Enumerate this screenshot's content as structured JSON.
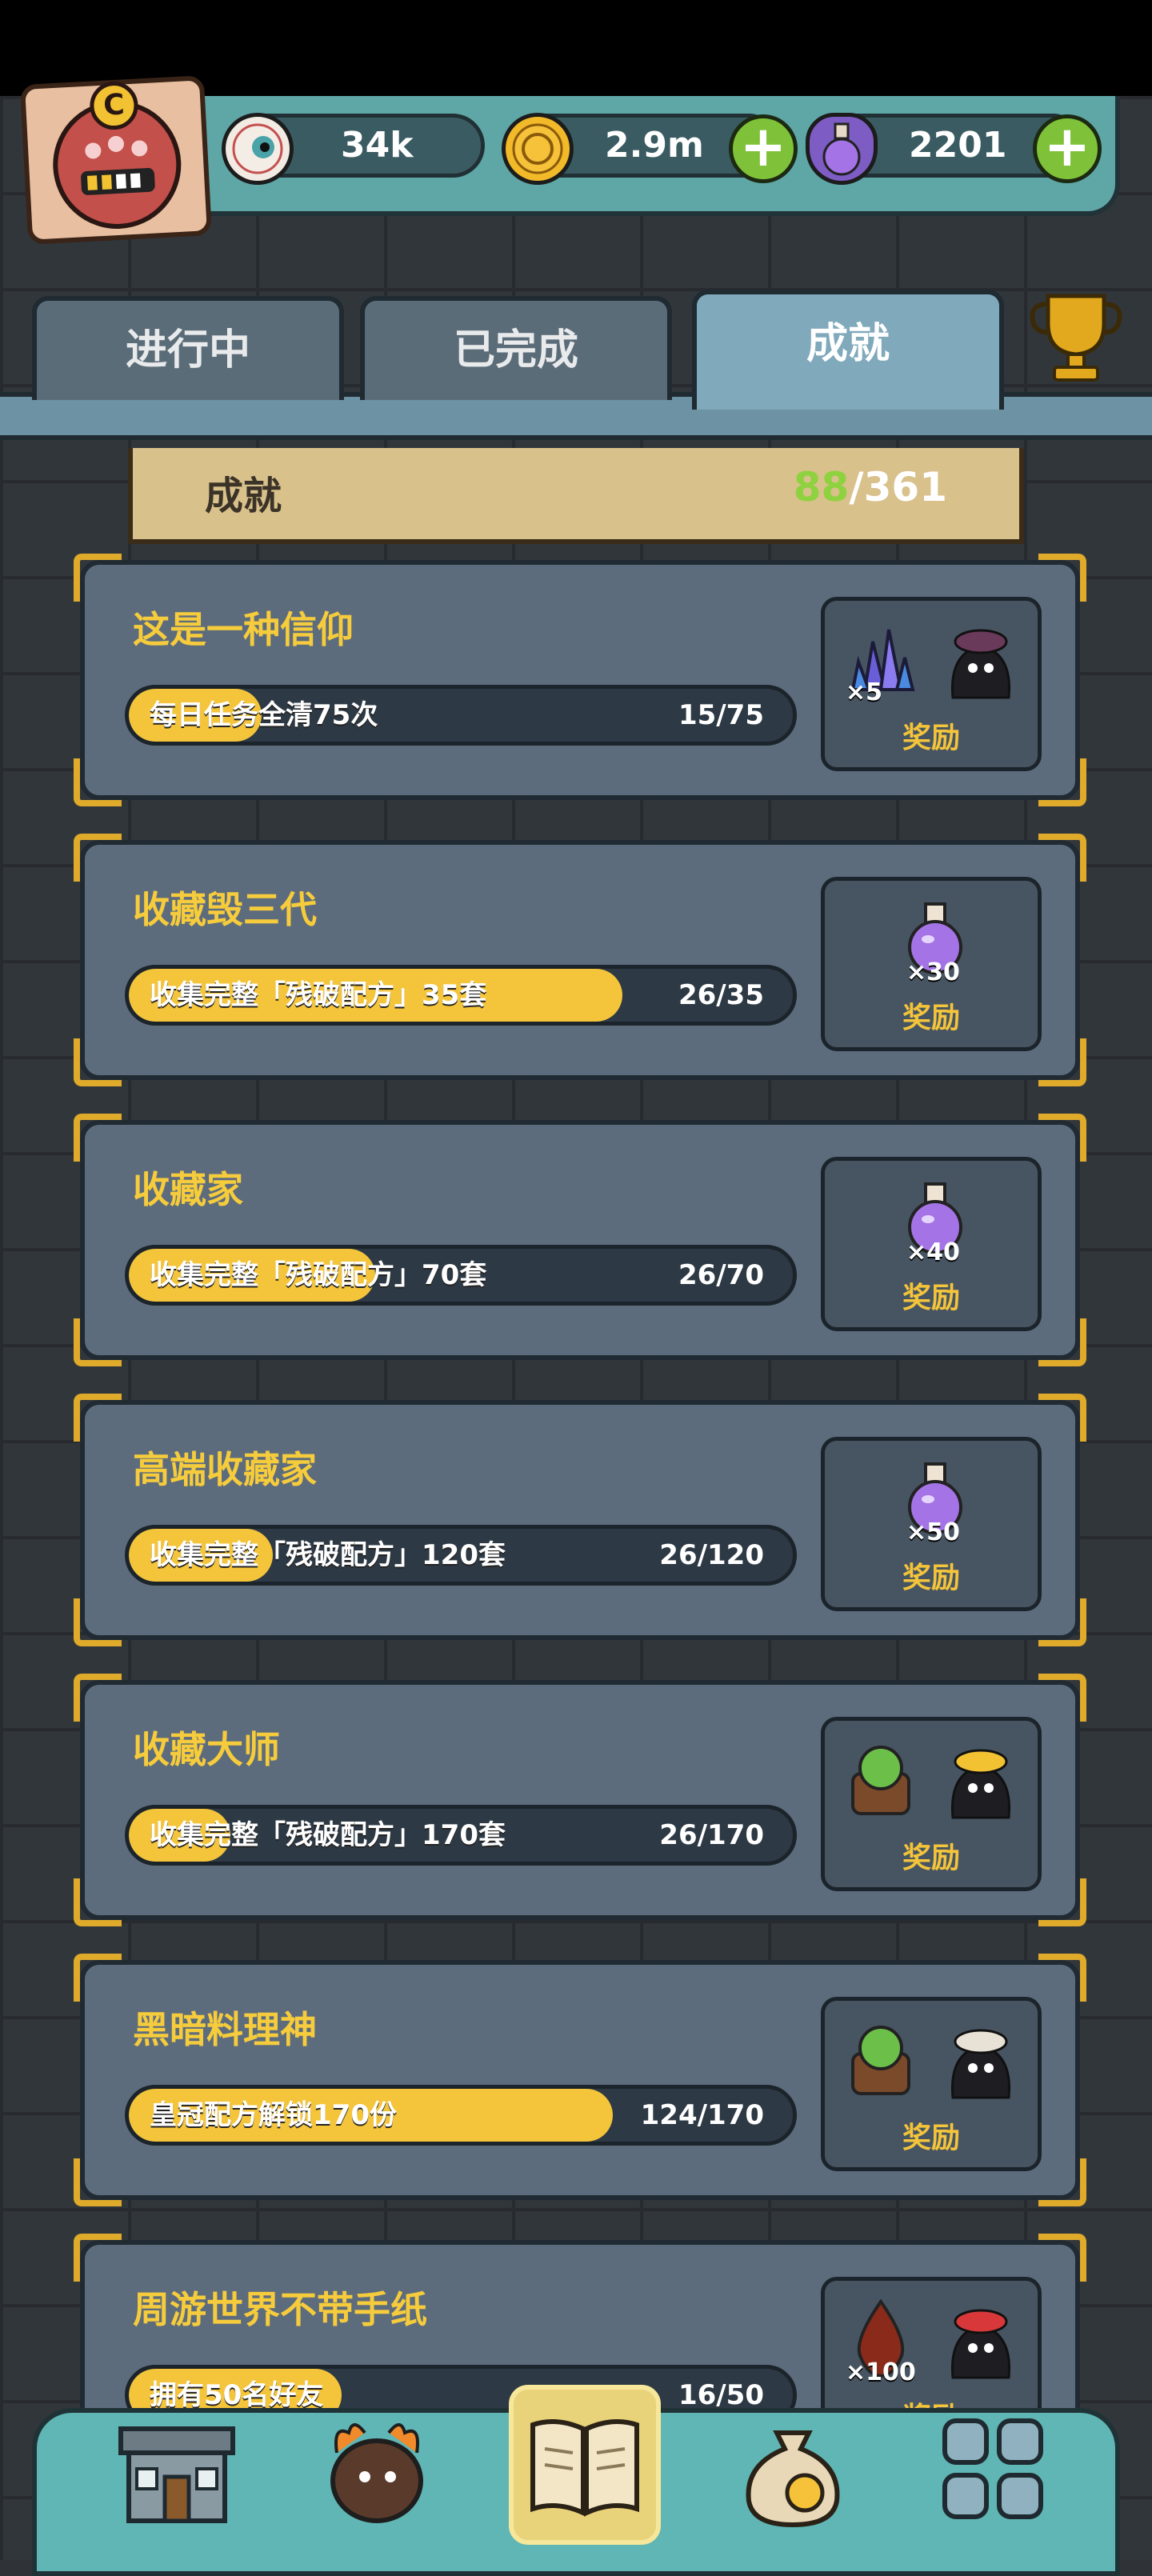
{
  "resources": {
    "eyes": {
      "icon": "eyeball-icon",
      "value": "34k"
    },
    "coins": {
      "icon": "coin-icon",
      "value": "2.9m"
    },
    "potions": {
      "icon": "potion-icon",
      "value": "2201"
    }
  },
  "avatar": {
    "badge": "C"
  },
  "tabs": [
    {
      "label": "进行中",
      "active": false
    },
    {
      "label": "已完成",
      "active": false
    },
    {
      "label": "成就",
      "active": true
    }
  ],
  "achievement_header": {
    "title": "成就",
    "done": "88",
    "total": "/361"
  },
  "achievements": [
    {
      "title": "这是一种信仰",
      "task": "每日任务全清75次",
      "progress": "15/75",
      "fraction": 0.2,
      "rewards": [
        {
          "icon": "crystal-cluster-icon",
          "count": "×5"
        },
        {
          "icon": "party-hat-character-icon",
          "count": ""
        }
      ],
      "reward_label": "奖励"
    },
    {
      "title": "收藏毁三代",
      "task": "收集完整「残破配方」35套",
      "progress": "26/35",
      "fraction": 0.743,
      "rewards": [
        {
          "icon": "purple-potion-icon",
          "count": "×30"
        }
      ],
      "reward_label": "奖励"
    },
    {
      "title": "收藏家",
      "task": "收集完整「残破配方」70套",
      "progress": "26/70",
      "fraction": 0.371,
      "rewards": [
        {
          "icon": "purple-potion-icon",
          "count": "×40"
        }
      ],
      "reward_label": "奖励"
    },
    {
      "title": "高端收藏家",
      "task": "收集完整「残破配方」120套",
      "progress": "26/120",
      "fraction": 0.217,
      "rewards": [
        {
          "icon": "purple-potion-icon",
          "count": "×50"
        }
      ],
      "reward_label": "奖励"
    },
    {
      "title": "收藏大师",
      "task": "收集完整「残破配方」170套",
      "progress": "26/170",
      "fraction": 0.153,
      "rewards": [
        {
          "icon": "cabbage-basket-icon",
          "count": ""
        },
        {
          "icon": "gold-hat-character-icon",
          "count": ""
        }
      ],
      "reward_label": "奖励"
    },
    {
      "title": "黑暗料理神",
      "task": "皇冠配方解锁170份",
      "progress": "124/170",
      "fraction": 0.729,
      "rewards": [
        {
          "icon": "cabbage-basket-icon",
          "count": ""
        },
        {
          "icon": "white-hat-character-icon",
          "count": ""
        }
      ],
      "reward_label": "奖励"
    },
    {
      "title": "周游世界不带手纸",
      "task": "拥有50名好友",
      "progress": "16/50",
      "fraction": 0.32,
      "rewards": [
        {
          "icon": "blood-drop-icon",
          "count": "×100"
        },
        {
          "icon": "red-cap-character-icon",
          "count": ""
        }
      ],
      "reward_label": "奖励"
    }
  ],
  "bottom_nav": [
    {
      "icon": "shop-building-icon",
      "active": false
    },
    {
      "icon": "monster-furnace-icon",
      "active": false
    },
    {
      "icon": "open-book-icon",
      "active": true
    },
    {
      "icon": "money-bag-icon",
      "active": false
    },
    {
      "icon": "grid-menu-icon",
      "active": false
    }
  ],
  "colors": {
    "accent_gold": "#f4c43a",
    "done_green": "#8ed23f",
    "teal": "#5fa6a7"
  }
}
